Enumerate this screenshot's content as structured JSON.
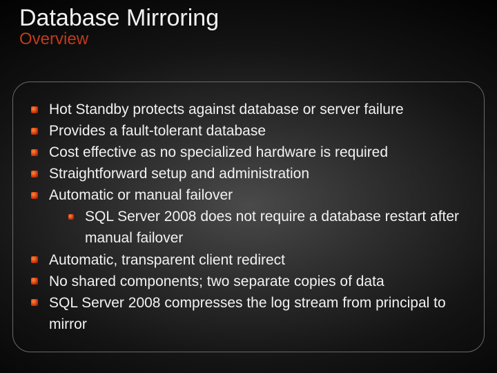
{
  "title": "Database Mirroring",
  "subtitle": "Overview",
  "bullets": {
    "b0": "Hot Standby protects against database or server failure",
    "b1": "Provides a fault-tolerant database",
    "b2": "Cost effective as no specialized hardware is required",
    "b3": "Straightforward setup and administration",
    "b4": "Automatic or manual failover",
    "b4_sub0": "SQL Server 2008 does not require a database restart after manual failover",
    "b5": "Automatic, transparent client redirect",
    "b6": "No shared components; two separate copies of data",
    "b7": "SQL Server 2008 compresses the log stream from principal to mirror"
  }
}
